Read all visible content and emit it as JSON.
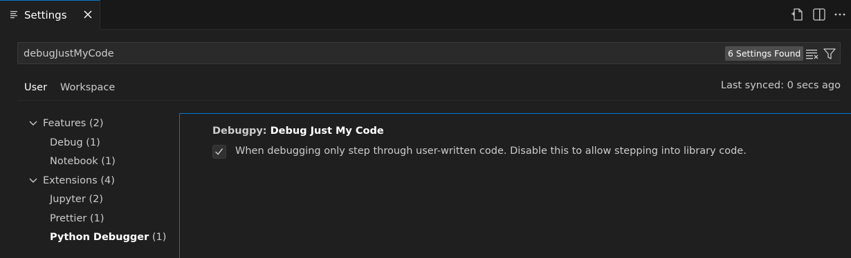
{
  "tab": {
    "label": "Settings",
    "icon": "settings-list-icon",
    "close_icon": "close-icon"
  },
  "editor_actions": [
    {
      "icon": "open-settings-json-icon"
    },
    {
      "icon": "split-editor-icon"
    },
    {
      "icon": "more-actions-icon"
    }
  ],
  "search": {
    "value": "debugJustMyCode",
    "found_label": "6 Settings Found",
    "clear_icon": "clear-filter-icon",
    "filter_icon": "filter-icon"
  },
  "scope": {
    "tabs": [
      {
        "label": "User",
        "active": true
      },
      {
        "label": "Workspace",
        "active": false
      }
    ],
    "sync_status": "Last synced: 0 secs ago"
  },
  "toc": {
    "groups": [
      {
        "label": "Features",
        "count": "(2)",
        "children": [
          {
            "label": "Debug",
            "count": "(1)"
          },
          {
            "label": "Notebook",
            "count": "(1)"
          }
        ]
      },
      {
        "label": "Extensions",
        "count": "(4)",
        "children": [
          {
            "label": "Jupyter",
            "count": "(2)"
          },
          {
            "label": "Prettier",
            "count": "(1)"
          },
          {
            "label": "Python Debugger",
            "count": "(1)",
            "selected": true
          }
        ]
      }
    ]
  },
  "setting": {
    "category": "Debugpy: ",
    "name": "Debug Just My Code",
    "checked": true,
    "description": "When debugging only step through user-written code. Disable this to allow stepping into library code."
  },
  "colors": {
    "accent": "#0078d4",
    "background": "#1f1f1f",
    "badge": "#4d4d4d"
  }
}
